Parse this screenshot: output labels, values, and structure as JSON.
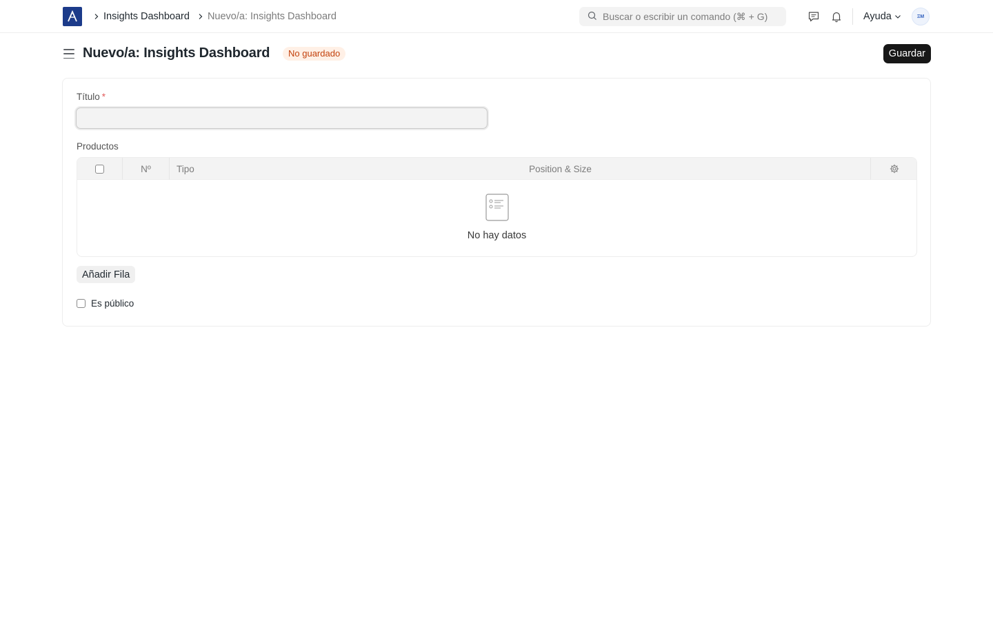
{
  "navbar": {
    "breadcrumbs": [
      "Insights Dashboard",
      "Nuevo/a: Insights Dashboard"
    ],
    "search": {
      "placeholder": "Buscar o escribir un comando (⌘ + G)"
    },
    "help_label": "Ayuda",
    "avatar_initials": "ΞΜ",
    "brand_color": "#1c3b8a"
  },
  "page": {
    "title": "Nuevo/a: Insights Dashboard",
    "status": "No guardado",
    "save_label": "Guardar"
  },
  "form": {
    "title_label": "Título",
    "title_required_mark": "*",
    "title_value": "",
    "products_label": "Productos",
    "table": {
      "columns": [
        "Nº",
        "Tipo",
        "Position & Size"
      ],
      "empty_text": "No hay datos"
    },
    "add_row_label": "Añadir Fila",
    "public_label": "Es público"
  }
}
